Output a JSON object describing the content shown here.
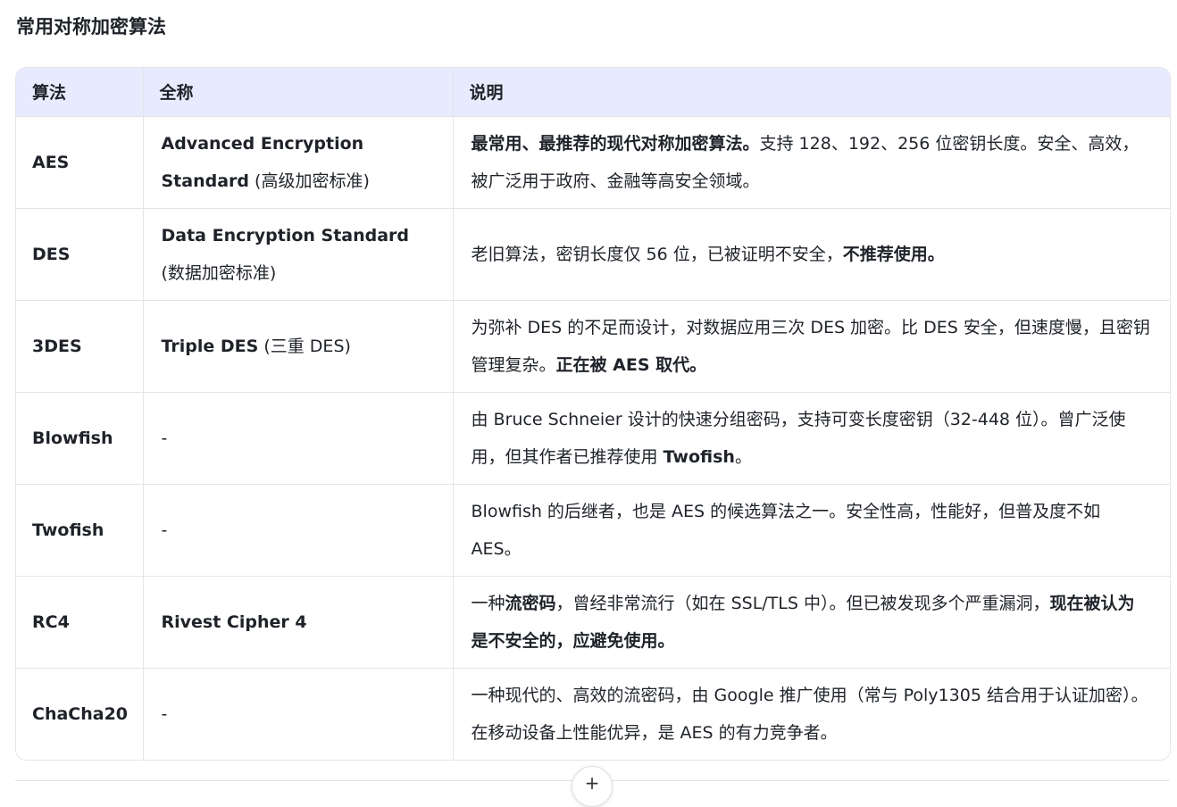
{
  "section_title": "常用对称加密算法",
  "table": {
    "headers": [
      "算法",
      "全称",
      "说明"
    ],
    "rows": [
      {
        "name": "AES",
        "full": [
          {
            "b": "Advanced Encryption Standard"
          },
          {
            "t": " (高级加密标准)"
          }
        ],
        "desc": [
          {
            "b": "最常用、最推荐的现代对称加密算法。"
          },
          {
            "t": "支持 128、192、256 位密钥长度。安全、高效，被广泛用于政府、金融等高安全领域。"
          }
        ]
      },
      {
        "name": "DES",
        "full": [
          {
            "b": "Data Encryption Standard"
          },
          {
            "t": " (数据加密标准)"
          }
        ],
        "desc": [
          {
            "t": "老旧算法，密钥长度仅 56 位，已被证明不安全，"
          },
          {
            "b": "不推荐使用。"
          }
        ]
      },
      {
        "name": "3DES",
        "full": [
          {
            "b": "Triple DES"
          },
          {
            "t": " (三重 DES)"
          }
        ],
        "desc": [
          {
            "t": "为弥补 DES 的不足而设计，对数据应用三次 DES 加密。比 DES 安全，但速度慢，且密钥管理复杂。"
          },
          {
            "b": "正在被 AES 取代。"
          }
        ]
      },
      {
        "name": "Blowfish",
        "full": [
          {
            "t": "-"
          }
        ],
        "desc": [
          {
            "t": "由 Bruce Schneier 设计的快速分组密码，支持可变长度密钥（32-448 位）。曾广泛使用，但其作者已推荐使用 "
          },
          {
            "b": "Twofish"
          },
          {
            "t": "。"
          }
        ]
      },
      {
        "name": "Twofish",
        "full": [
          {
            "t": "-"
          }
        ],
        "desc": [
          {
            "t": "Blowfish 的后继者，也是 AES 的候选算法之一。安全性高，性能好，但普及度不如 AES。"
          }
        ]
      },
      {
        "name": "RC4",
        "full": [
          {
            "b": "Rivest Cipher 4"
          }
        ],
        "desc": [
          {
            "t": "一种"
          },
          {
            "b": "流密码"
          },
          {
            "t": "，曾经非常流行（如在 SSL/TLS 中）。但已被发现多个严重漏洞，"
          },
          {
            "b": "现在被认为是不安全的，应避免使用。"
          }
        ]
      },
      {
        "name": "ChaCha20",
        "full": [
          {
            "t": "-"
          }
        ],
        "desc": [
          {
            "t": "一种现代的、高效的流密码，由 Google 推广使用（常与 Poly1305 结合用于认证加密）。在移动设备上性能优异，是 AES 的有力竞争者。"
          }
        ]
      }
    ]
  },
  "add_button": {
    "icon": "plus-icon",
    "glyph": "+"
  }
}
